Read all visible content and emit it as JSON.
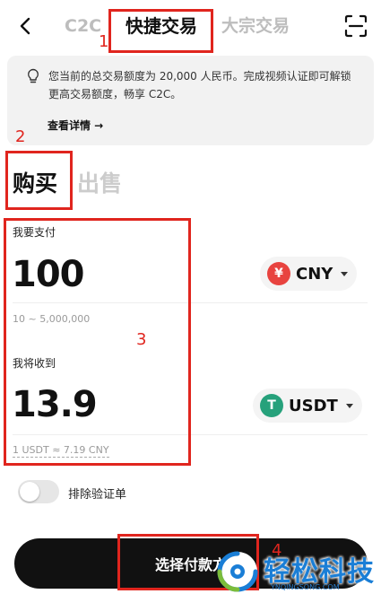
{
  "header": {
    "tabs": [
      {
        "label": "C2C",
        "active": false
      },
      {
        "label": "快捷交易",
        "active": true
      },
      {
        "label": "大宗交易",
        "active": false
      }
    ],
    "icons": {
      "back": "chevron-left-icon",
      "scan": "scan-icon"
    }
  },
  "notice": {
    "icon": "lightbulb-icon",
    "text": "您当前的总交易额度为 20,000 人民币。完成视频认证即可解锁更高交易额度，畅享 C2C。",
    "link_label": "查看详情 →"
  },
  "trade_side": {
    "buy_label": "购买",
    "sell_label": "出售",
    "active": "购买"
  },
  "pay": {
    "label": "我要支付",
    "amount": "100",
    "range_hint": "10 ~ 5,000,000",
    "currency": {
      "symbol": "¥",
      "code": "CNY"
    }
  },
  "receive": {
    "label": "我将收到",
    "amount": "13.9",
    "rate_hint": "1 USDT ≈ 7.19 CNY",
    "currency": {
      "symbol": "T",
      "code": "USDT"
    }
  },
  "toggle": {
    "label": "排除验证单",
    "on": false
  },
  "cta": {
    "label": "选择付款方"
  },
  "annotations": {
    "n1": "1",
    "n2": "2",
    "n3": "3",
    "n4": "4"
  },
  "watermark": {
    "text": "轻松科技",
    "sub": "YNQINGSONG.COM"
  },
  "colors": {
    "accent_red": "#e0251e",
    "cny_coin": "#e8433f",
    "usdt_coin": "#26a17b",
    "cta_bg": "#111111",
    "watermark_blue": "#1a7ed6"
  }
}
